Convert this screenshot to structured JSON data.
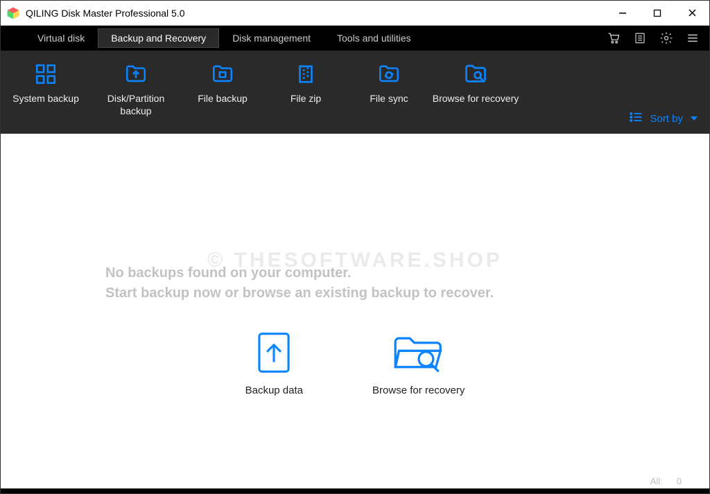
{
  "window": {
    "title": "QILING Disk Master Professional 5.0"
  },
  "tabs": [
    {
      "label": "Virtual disk",
      "active": false
    },
    {
      "label": "Backup and Recovery",
      "active": true
    },
    {
      "label": "Disk management",
      "active": false
    },
    {
      "label": "Tools and utilities",
      "active": false
    }
  ],
  "toolbar": {
    "items": [
      {
        "label": "System backup",
        "icon": "grid-icon"
      },
      {
        "label": "Disk/Partition backup",
        "icon": "folder-up-icon"
      },
      {
        "label": "File backup",
        "icon": "folder-small-icon"
      },
      {
        "label": "File zip",
        "icon": "zip-icon"
      },
      {
        "label": "File sync",
        "icon": "folder-sync-icon"
      },
      {
        "label": "Browse for recovery",
        "icon": "folder-search-icon"
      }
    ],
    "sort_label": "Sort by"
  },
  "main": {
    "watermark": "© THESOFTWARE.SHOP",
    "line1": "No backups found on your computer.",
    "line2": "Start backup now or browse an existing backup to recover.",
    "actions": [
      {
        "label": "Backup data",
        "icon": "backup-data-icon"
      },
      {
        "label": "Browse for recovery",
        "icon": "browse-recovery-icon"
      }
    ]
  },
  "status": {
    "label": "All:",
    "count": "0"
  }
}
